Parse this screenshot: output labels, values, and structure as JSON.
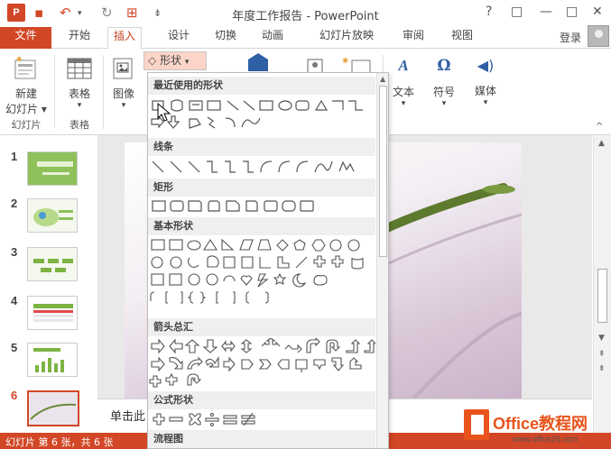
{
  "window": {
    "title": "年度工作报告 - PowerPoint",
    "app_icon_text": "P",
    "help": "?",
    "restore": "□",
    "minimize": "—",
    "close": "✕"
  },
  "tabs": [
    {
      "label": "文件"
    },
    {
      "label": "开始"
    },
    {
      "label": "插入"
    },
    {
      "label": "设计"
    },
    {
      "label": "切换"
    },
    {
      "label": "动画"
    },
    {
      "label": "幻灯片放映"
    },
    {
      "label": "审阅"
    },
    {
      "label": "视图"
    }
  ],
  "login": "登录",
  "ribbon": {
    "new_slide": "新建\n幻灯片",
    "new_slide_l1": "新建",
    "new_slide_l2": "幻灯片 ▾",
    "group_slides": "幻灯片",
    "table": "表格",
    "group_table": "表格",
    "image": "图像",
    "shapes": "形状",
    "text": "文本",
    "symbol": "符号",
    "media": "媒体"
  },
  "dropdown": {
    "sections": [
      "最近使用的形状",
      "线条",
      "矩形",
      "基本形状",
      "箭头总汇",
      "公式形状",
      "流程图"
    ]
  },
  "slides": [
    {
      "num": "1"
    },
    {
      "num": "2"
    },
    {
      "num": "3"
    },
    {
      "num": "4"
    },
    {
      "num": "5"
    },
    {
      "num": "6"
    }
  ],
  "notes_placeholder": "单击此",
  "status": "幻灯片 第 6 张，共 6 张",
  "watermark": {
    "brand": "Office教程网",
    "url": "www.office26.com"
  },
  "colors": {
    "accent": "#d24726",
    "ribbon_tab_active": "#c43e1c",
    "slide_green": "#4f7a2a"
  }
}
